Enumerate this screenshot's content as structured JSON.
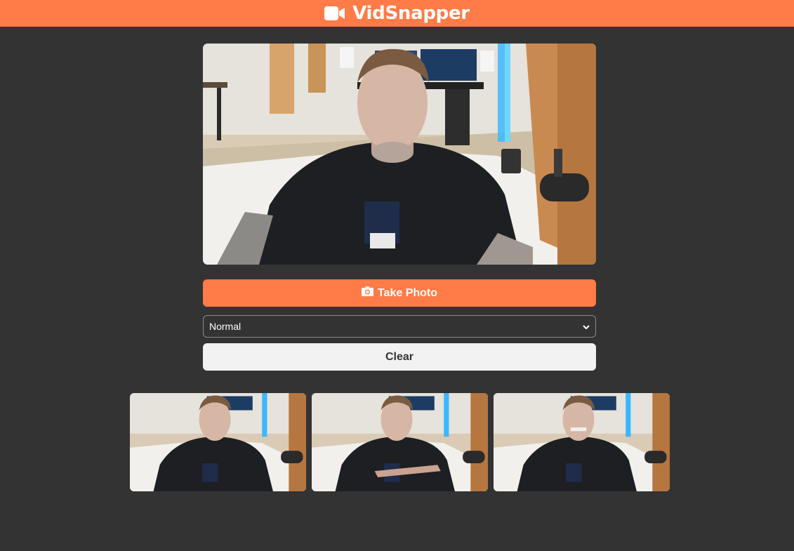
{
  "app": {
    "title": "VidSnapper",
    "brand_color": "#ff7b47",
    "background_color": "#333333",
    "logo_icon": "video-camera-icon"
  },
  "video": {
    "description_icon": "webcam-feed"
  },
  "controls": {
    "take_photo_label": "Take Photo",
    "take_photo_icon": "camera-icon",
    "filter_selected": "Normal",
    "clear_label": "Clear"
  },
  "gallery": {
    "photos": [
      {
        "pose": "smile"
      },
      {
        "pose": "gesture"
      },
      {
        "pose": "grimace"
      }
    ]
  }
}
